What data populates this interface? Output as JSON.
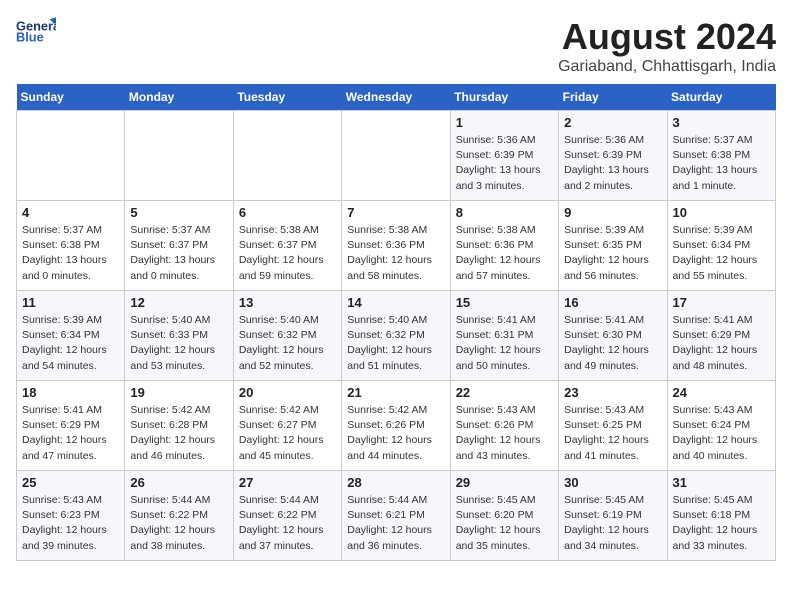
{
  "logo": {
    "line1": "General",
    "line2": "Blue"
  },
  "title": "August 2024",
  "subtitle": "Gariaband, Chhattisgarh, India",
  "days_of_week": [
    "Sunday",
    "Monday",
    "Tuesday",
    "Wednesday",
    "Thursday",
    "Friday",
    "Saturday"
  ],
  "weeks": [
    [
      {
        "day": "",
        "info": ""
      },
      {
        "day": "",
        "info": ""
      },
      {
        "day": "",
        "info": ""
      },
      {
        "day": "",
        "info": ""
      },
      {
        "day": "1",
        "info": "Sunrise: 5:36 AM\nSunset: 6:39 PM\nDaylight: 13 hours\nand 3 minutes."
      },
      {
        "day": "2",
        "info": "Sunrise: 5:36 AM\nSunset: 6:39 PM\nDaylight: 13 hours\nand 2 minutes."
      },
      {
        "day": "3",
        "info": "Sunrise: 5:37 AM\nSunset: 6:38 PM\nDaylight: 13 hours\nand 1 minute."
      }
    ],
    [
      {
        "day": "4",
        "info": "Sunrise: 5:37 AM\nSunset: 6:38 PM\nDaylight: 13 hours\nand 0 minutes."
      },
      {
        "day": "5",
        "info": "Sunrise: 5:37 AM\nSunset: 6:37 PM\nDaylight: 13 hours\nand 0 minutes."
      },
      {
        "day": "6",
        "info": "Sunrise: 5:38 AM\nSunset: 6:37 PM\nDaylight: 12 hours\nand 59 minutes."
      },
      {
        "day": "7",
        "info": "Sunrise: 5:38 AM\nSunset: 6:36 PM\nDaylight: 12 hours\nand 58 minutes."
      },
      {
        "day": "8",
        "info": "Sunrise: 5:38 AM\nSunset: 6:36 PM\nDaylight: 12 hours\nand 57 minutes."
      },
      {
        "day": "9",
        "info": "Sunrise: 5:39 AM\nSunset: 6:35 PM\nDaylight: 12 hours\nand 56 minutes."
      },
      {
        "day": "10",
        "info": "Sunrise: 5:39 AM\nSunset: 6:34 PM\nDaylight: 12 hours\nand 55 minutes."
      }
    ],
    [
      {
        "day": "11",
        "info": "Sunrise: 5:39 AM\nSunset: 6:34 PM\nDaylight: 12 hours\nand 54 minutes."
      },
      {
        "day": "12",
        "info": "Sunrise: 5:40 AM\nSunset: 6:33 PM\nDaylight: 12 hours\nand 53 minutes."
      },
      {
        "day": "13",
        "info": "Sunrise: 5:40 AM\nSunset: 6:32 PM\nDaylight: 12 hours\nand 52 minutes."
      },
      {
        "day": "14",
        "info": "Sunrise: 5:40 AM\nSunset: 6:32 PM\nDaylight: 12 hours\nand 51 minutes."
      },
      {
        "day": "15",
        "info": "Sunrise: 5:41 AM\nSunset: 6:31 PM\nDaylight: 12 hours\nand 50 minutes."
      },
      {
        "day": "16",
        "info": "Sunrise: 5:41 AM\nSunset: 6:30 PM\nDaylight: 12 hours\nand 49 minutes."
      },
      {
        "day": "17",
        "info": "Sunrise: 5:41 AM\nSunset: 6:29 PM\nDaylight: 12 hours\nand 48 minutes."
      }
    ],
    [
      {
        "day": "18",
        "info": "Sunrise: 5:41 AM\nSunset: 6:29 PM\nDaylight: 12 hours\nand 47 minutes."
      },
      {
        "day": "19",
        "info": "Sunrise: 5:42 AM\nSunset: 6:28 PM\nDaylight: 12 hours\nand 46 minutes."
      },
      {
        "day": "20",
        "info": "Sunrise: 5:42 AM\nSunset: 6:27 PM\nDaylight: 12 hours\nand 45 minutes."
      },
      {
        "day": "21",
        "info": "Sunrise: 5:42 AM\nSunset: 6:26 PM\nDaylight: 12 hours\nand 44 minutes."
      },
      {
        "day": "22",
        "info": "Sunrise: 5:43 AM\nSunset: 6:26 PM\nDaylight: 12 hours\nand 43 minutes."
      },
      {
        "day": "23",
        "info": "Sunrise: 5:43 AM\nSunset: 6:25 PM\nDaylight: 12 hours\nand 41 minutes."
      },
      {
        "day": "24",
        "info": "Sunrise: 5:43 AM\nSunset: 6:24 PM\nDaylight: 12 hours\nand 40 minutes."
      }
    ],
    [
      {
        "day": "25",
        "info": "Sunrise: 5:43 AM\nSunset: 6:23 PM\nDaylight: 12 hours\nand 39 minutes."
      },
      {
        "day": "26",
        "info": "Sunrise: 5:44 AM\nSunset: 6:22 PM\nDaylight: 12 hours\nand 38 minutes."
      },
      {
        "day": "27",
        "info": "Sunrise: 5:44 AM\nSunset: 6:22 PM\nDaylight: 12 hours\nand 37 minutes."
      },
      {
        "day": "28",
        "info": "Sunrise: 5:44 AM\nSunset: 6:21 PM\nDaylight: 12 hours\nand 36 minutes."
      },
      {
        "day": "29",
        "info": "Sunrise: 5:45 AM\nSunset: 6:20 PM\nDaylight: 12 hours\nand 35 minutes."
      },
      {
        "day": "30",
        "info": "Sunrise: 5:45 AM\nSunset: 6:19 PM\nDaylight: 12 hours\nand 34 minutes."
      },
      {
        "day": "31",
        "info": "Sunrise: 5:45 AM\nSunset: 6:18 PM\nDaylight: 12 hours\nand 33 minutes."
      }
    ]
  ]
}
